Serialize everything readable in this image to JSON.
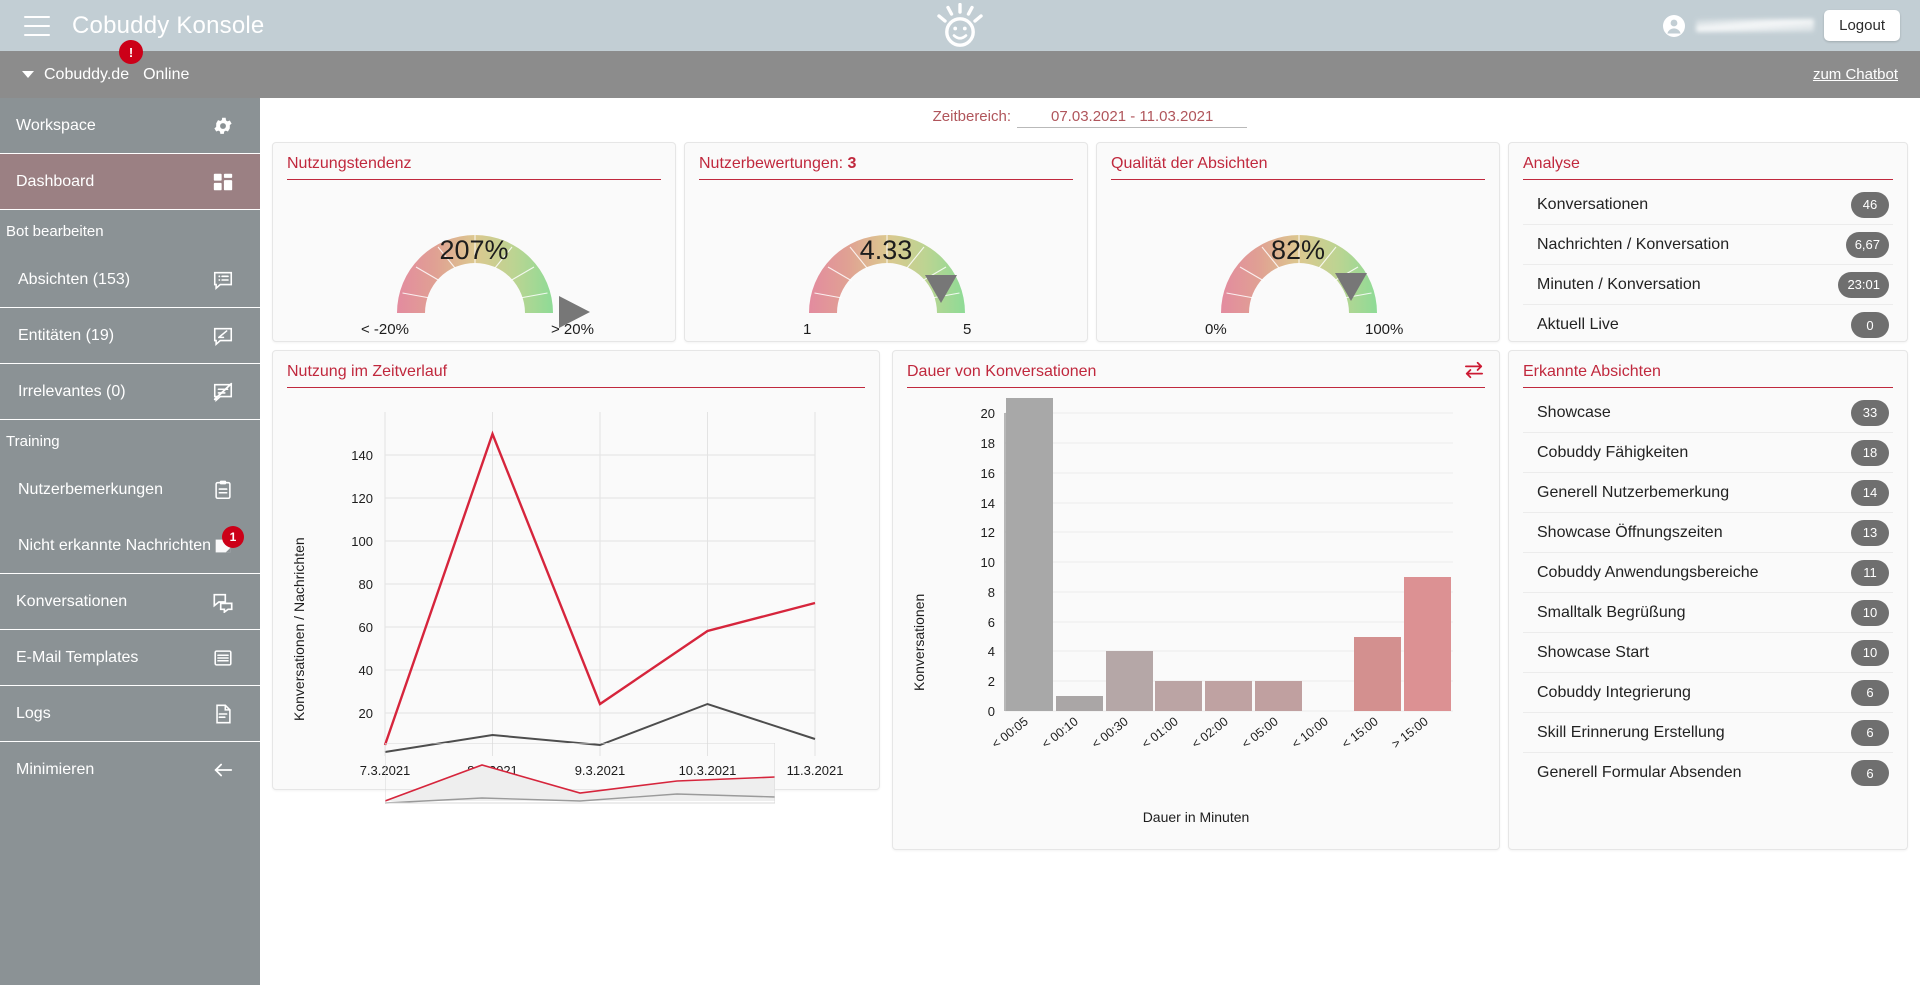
{
  "header": {
    "menu_icon": "hamburger-icon",
    "title": "Cobuddy Konsole",
    "logo_icon": "smiley-sun-logo",
    "avatar_icon": "user-avatar-icon",
    "username_redacted": "",
    "logout_label": "Logout"
  },
  "subheader": {
    "caret_icon": "chevron-down-icon",
    "bot_name": "Cobuddy.de",
    "status": "Online",
    "alert_badge": "!",
    "chatbot_link": "zum Chatbot"
  },
  "sidebar": {
    "items": [
      {
        "label": "Workspace",
        "icon": "gear-icon",
        "active": false,
        "group": false,
        "badge": null
      },
      {
        "label": "Dashboard",
        "icon": "dashboard-grid-icon",
        "active": true,
        "group": false,
        "badge": null
      },
      {
        "label": "Bot bearbeiten",
        "icon": null,
        "active": false,
        "group": true,
        "badge": null
      },
      {
        "label": "Absichten (153)",
        "icon": "intent-list-icon",
        "active": false,
        "group": false,
        "badge": null
      },
      {
        "label": "Entitäten (19)",
        "icon": "entity-edit-icon",
        "active": false,
        "group": false,
        "badge": null
      },
      {
        "label": "Irrelevantes (0)",
        "icon": "irrelevant-slash-icon",
        "active": false,
        "group": false,
        "badge": null
      },
      {
        "label": "Training",
        "icon": null,
        "active": false,
        "group": true,
        "badge": null
      },
      {
        "label": "Nutzerbemerkungen",
        "icon": "clipboard-icon",
        "active": false,
        "group": false,
        "badge": null
      },
      {
        "label": "Nicht erkannte Nachrichten",
        "icon": "document-page-icon",
        "active": false,
        "group": false,
        "badge": "1"
      },
      {
        "label": "Konversationen",
        "icon": "chat-bubbles-icon",
        "active": false,
        "group": false,
        "badge": null
      },
      {
        "label": "E-Mail Templates",
        "icon": "email-template-icon",
        "active": false,
        "group": false,
        "badge": null
      },
      {
        "label": "Logs",
        "icon": "log-file-icon",
        "active": false,
        "group": false,
        "badge": null
      },
      {
        "label": "Minimieren",
        "icon": "arrow-left-icon",
        "active": false,
        "group": false,
        "badge": null
      }
    ]
  },
  "timerange": {
    "label": "Zeitbereich:",
    "value": "07.03.2021 - 11.03.2021"
  },
  "gauges": [
    {
      "title": "Nutzungstendenz",
      "title_bold": "",
      "value": "207%",
      "low": "< -20%",
      "high": "> 20%",
      "needle_pct": 100
    },
    {
      "title": "Nutzerbewertungen: ",
      "title_bold": "3",
      "value": "4.33",
      "low": "1",
      "high": "5",
      "needle_pct": 83
    },
    {
      "title": "Qualität der Absichten",
      "title_bold": "",
      "value": "82%",
      "low": "0%",
      "high": "100%",
      "needle_pct": 82
    }
  ],
  "analyse": {
    "title": "Analyse",
    "rows": [
      {
        "name": "Konversationen",
        "value": "46"
      },
      {
        "name": "Nachrichten / Konversation",
        "value": "6,67"
      },
      {
        "name": "Minuten / Konversation",
        "value": "23:01"
      },
      {
        "name": "Aktuell Live",
        "value": "0"
      }
    ]
  },
  "intents": {
    "title": "Erkannte Absichten",
    "rows": [
      {
        "name": "Showcase",
        "value": "33"
      },
      {
        "name": "Cobuddy Fähigkeiten",
        "value": "18"
      },
      {
        "name": "Generell  Nutzerbemerkung",
        "value": "14"
      },
      {
        "name": "Showcase  Öffnungszeiten",
        "value": "13"
      },
      {
        "name": "Cobuddy Anwendungsbereiche",
        "value": "11"
      },
      {
        "name": "Smalltalk Begrüßung",
        "value": "10"
      },
      {
        "name": "Showcase Start",
        "value": "10"
      },
      {
        "name": "Cobuddy Integrierung",
        "value": "6"
      },
      {
        "name": "Skill Erinnerung Erstellung",
        "value": "6"
      },
      {
        "name": "Generell Formular Absenden",
        "value": "6"
      }
    ]
  },
  "chart_data": [
    {
      "type": "line",
      "title": "Nutzung im Zeitverlauf",
      "xlabel": "",
      "ylabel": "Konversationen / Nachrichten",
      "categories": [
        "7.3.2021",
        "8.3.2021",
        "9.3.2021",
        "10.3.2021",
        "11.3.2021"
      ],
      "ylim": [
        0,
        150
      ],
      "yticks": [
        20,
        40,
        60,
        80,
        100,
        120,
        140
      ],
      "grid": true,
      "legend": "none",
      "series": [
        {
          "name": "Nachrichten",
          "color": "#d6253c",
          "values": [
            5,
            150,
            24,
            58,
            71
          ]
        },
        {
          "name": "Konversationen",
          "color": "#4d4d4d",
          "values": [
            2,
            10,
            5,
            24,
            8
          ]
        }
      ],
      "has_range_selector": true
    },
    {
      "type": "bar",
      "title": "Dauer von Konversationen",
      "swap_icon": "swap-arrows-icon",
      "xlabel": "Dauer in Minuten",
      "ylabel": "Konversationen",
      "categories": [
        "< 00:05",
        "< 00:10",
        "< 00:30",
        "< 01:00",
        "< 02:00",
        "< 05:00",
        "< 10:00",
        "< 15:00",
        "> 15:00"
      ],
      "values": [
        21,
        1,
        4,
        2,
        2,
        2,
        0,
        5,
        9
      ],
      "ylim": [
        0,
        21
      ],
      "yticks": [
        0,
        2,
        4,
        6,
        8,
        10,
        12,
        14,
        16,
        18,
        20
      ],
      "grid": true,
      "bar_colors": [
        "#a8a8a8",
        "#aaa6a6",
        "#b5a7a7",
        "#bba4a4",
        "#bfa2a2",
        "#c0a0a0",
        "#c89b9b",
        "#d3908f",
        "#dc9193"
      ]
    }
  ],
  "colors": {
    "accent_red": "#c0283d",
    "topbar": "#c2ced4",
    "subbar": "#8c8c8c",
    "sidebar": "#8b9295",
    "sidebar_active": "#9b8083",
    "badge_red": "#cc0018",
    "pill_gray": "#6f6f6f"
  }
}
